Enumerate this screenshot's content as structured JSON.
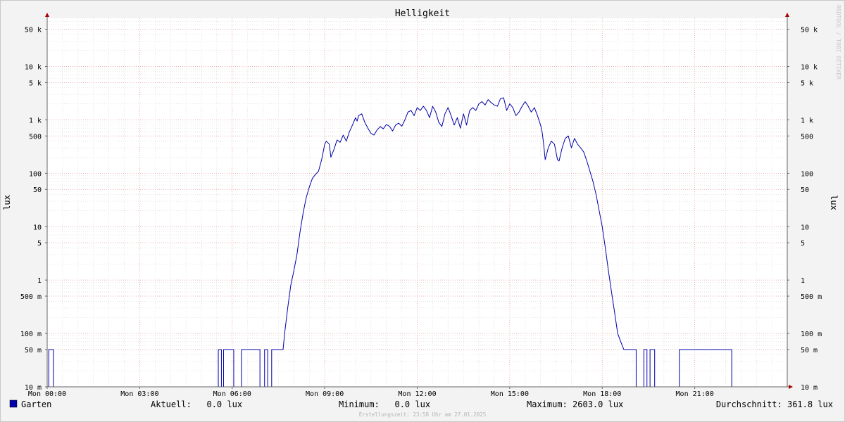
{
  "chart_data": {
    "type": "line",
    "title": "Helligkeit",
    "ylabel": "lux",
    "yscale": "log",
    "ylim": [
      0.01,
      80000
    ],
    "xlim_hours": [
      0,
      24
    ],
    "grid": true,
    "yticks": [
      {
        "value": 50000,
        "label": "50 k"
      },
      {
        "value": 10000,
        "label": "10 k"
      },
      {
        "value": 5000,
        "label": "5 k"
      },
      {
        "value": 1000,
        "label": "1 k"
      },
      {
        "value": 500,
        "label": "500"
      },
      {
        "value": 100,
        "label": "100"
      },
      {
        "value": 50,
        "label": "50"
      },
      {
        "value": 10,
        "label": "10"
      },
      {
        "value": 5,
        "label": "5"
      },
      {
        "value": 1,
        "label": "1"
      },
      {
        "value": 0.5,
        "label": "500 m"
      },
      {
        "value": 0.1,
        "label": "100 m"
      },
      {
        "value": 0.05,
        "label": "50 m"
      },
      {
        "value": 0.01,
        "label": "10 m"
      }
    ],
    "xticks": [
      {
        "hour": 0,
        "label": "Mon 00:00"
      },
      {
        "hour": 3,
        "label": "Mon 03:00"
      },
      {
        "hour": 6,
        "label": "Mon 06:00"
      },
      {
        "hour": 9,
        "label": "Mon 09:00"
      },
      {
        "hour": 12,
        "label": "Mon 12:00"
      },
      {
        "hour": 15,
        "label": "Mon 15:00"
      },
      {
        "hour": 18,
        "label": "Mon 18:00"
      },
      {
        "hour": 21,
        "label": "Mon 21:00"
      }
    ],
    "series": [
      {
        "name": "Garten",
        "color": "#0000aa",
        "points": [
          [
            0.0,
            0.01
          ],
          [
            0.05,
            0.01
          ],
          [
            0.05,
            0.05
          ],
          [
            0.2,
            0.05
          ],
          [
            0.2,
            0.01
          ],
          [
            5.55,
            0.01
          ],
          [
            5.55,
            0.05
          ],
          [
            5.65,
            0.05
          ],
          [
            5.65,
            0.01
          ],
          [
            5.72,
            0.01
          ],
          [
            5.72,
            0.05
          ],
          [
            6.05,
            0.05
          ],
          [
            6.05,
            0.01
          ],
          [
            6.3,
            0.01
          ],
          [
            6.3,
            0.05
          ],
          [
            6.9,
            0.05
          ],
          [
            6.9,
            0.01
          ],
          [
            7.05,
            0.01
          ],
          [
            7.05,
            0.05
          ],
          [
            7.15,
            0.05
          ],
          [
            7.15,
            0.01
          ],
          [
            7.28,
            0.01
          ],
          [
            7.28,
            0.05
          ],
          [
            7.65,
            0.05
          ],
          [
            7.7,
            0.1
          ],
          [
            7.8,
            0.3
          ],
          [
            7.9,
            0.8
          ],
          [
            8.0,
            1.5
          ],
          [
            8.1,
            3
          ],
          [
            8.2,
            8
          ],
          [
            8.3,
            18
          ],
          [
            8.4,
            35
          ],
          [
            8.5,
            55
          ],
          [
            8.6,
            80
          ],
          [
            8.7,
            95
          ],
          [
            8.8,
            110
          ],
          [
            8.9,
            180
          ],
          [
            9.0,
            350
          ],
          [
            9.05,
            400
          ],
          [
            9.15,
            350
          ],
          [
            9.2,
            200
          ],
          [
            9.3,
            280
          ],
          [
            9.4,
            420
          ],
          [
            9.5,
            380
          ],
          [
            9.6,
            520
          ],
          [
            9.7,
            400
          ],
          [
            9.8,
            600
          ],
          [
            9.9,
            800
          ],
          [
            10.0,
            1100
          ],
          [
            10.05,
            950
          ],
          [
            10.1,
            1200
          ],
          [
            10.2,
            1300
          ],
          [
            10.3,
            900
          ],
          [
            10.4,
            700
          ],
          [
            10.5,
            560
          ],
          [
            10.6,
            520
          ],
          [
            10.7,
            650
          ],
          [
            10.8,
            750
          ],
          [
            10.9,
            680
          ],
          [
            11.0,
            820
          ],
          [
            11.1,
            760
          ],
          [
            11.2,
            620
          ],
          [
            11.3,
            800
          ],
          [
            11.4,
            870
          ],
          [
            11.5,
            760
          ],
          [
            11.6,
            1000
          ],
          [
            11.7,
            1400
          ],
          [
            11.8,
            1500
          ],
          [
            11.9,
            1200
          ],
          [
            12.0,
            1700
          ],
          [
            12.1,
            1500
          ],
          [
            12.2,
            1800
          ],
          [
            12.3,
            1500
          ],
          [
            12.4,
            1100
          ],
          [
            12.5,
            1800
          ],
          [
            12.6,
            1400
          ],
          [
            12.7,
            900
          ],
          [
            12.8,
            750
          ],
          [
            12.9,
            1300
          ],
          [
            13.0,
            1700
          ],
          [
            13.1,
            1200
          ],
          [
            13.2,
            800
          ],
          [
            13.3,
            1100
          ],
          [
            13.4,
            700
          ],
          [
            13.5,
            1300
          ],
          [
            13.6,
            800
          ],
          [
            13.7,
            1500
          ],
          [
            13.8,
            1700
          ],
          [
            13.9,
            1500
          ],
          [
            14.0,
            2000
          ],
          [
            14.1,
            2200
          ],
          [
            14.2,
            1900
          ],
          [
            14.3,
            2400
          ],
          [
            14.4,
            2100
          ],
          [
            14.5,
            1900
          ],
          [
            14.6,
            1800
          ],
          [
            14.7,
            2500
          ],
          [
            14.8,
            2600
          ],
          [
            14.85,
            2000
          ],
          [
            14.9,
            1500
          ],
          [
            15.0,
            2000
          ],
          [
            15.1,
            1700
          ],
          [
            15.2,
            1200
          ],
          [
            15.3,
            1400
          ],
          [
            15.4,
            1800
          ],
          [
            15.5,
            2200
          ],
          [
            15.6,
            1800
          ],
          [
            15.7,
            1400
          ],
          [
            15.8,
            1700
          ],
          [
            15.9,
            1200
          ],
          [
            16.0,
            800
          ],
          [
            16.05,
            600
          ],
          [
            16.1,
            350
          ],
          [
            16.15,
            180
          ],
          [
            16.25,
            300
          ],
          [
            16.35,
            400
          ],
          [
            16.45,
            350
          ],
          [
            16.55,
            180
          ],
          [
            16.6,
            170
          ],
          [
            16.7,
            300
          ],
          [
            16.8,
            450
          ],
          [
            16.9,
            500
          ],
          [
            17.0,
            300
          ],
          [
            17.1,
            450
          ],
          [
            17.2,
            350
          ],
          [
            17.3,
            300
          ],
          [
            17.4,
            250
          ],
          [
            17.5,
            170
          ],
          [
            17.6,
            110
          ],
          [
            17.7,
            70
          ],
          [
            17.8,
            40
          ],
          [
            17.9,
            20
          ],
          [
            18.0,
            10
          ],
          [
            18.1,
            4
          ],
          [
            18.2,
            1.5
          ],
          [
            18.3,
            0.6
          ],
          [
            18.4,
            0.25
          ],
          [
            18.5,
            0.1
          ],
          [
            18.6,
            0.07
          ],
          [
            18.7,
            0.05
          ],
          [
            19.1,
            0.05
          ],
          [
            19.1,
            0.01
          ],
          [
            19.35,
            0.01
          ],
          [
            19.35,
            0.05
          ],
          [
            19.45,
            0.05
          ],
          [
            19.45,
            0.01
          ],
          [
            19.55,
            0.01
          ],
          [
            19.55,
            0.05
          ],
          [
            19.7,
            0.05
          ],
          [
            19.7,
            0.01
          ],
          [
            20.5,
            0.01
          ],
          [
            20.5,
            0.05
          ],
          [
            22.2,
            0.05
          ],
          [
            22.2,
            0.01
          ],
          [
            24.0,
            0.01
          ]
        ]
      }
    ]
  },
  "watermark": "RRDTOOL / TOBI OETIKER",
  "legend": {
    "series_name": "Garten",
    "swatch_color": "#0000aa",
    "aktuell": "Aktuell:   0.0 lux",
    "minimum": "Minimum:   0.0 lux",
    "maximum": "Maximum: 2603.0 lux",
    "durchschnitt": "Durchschnitt: 361.8 lux"
  },
  "footer": "Erstellungszeit: 23:58 Uhr am 27.01.2025"
}
